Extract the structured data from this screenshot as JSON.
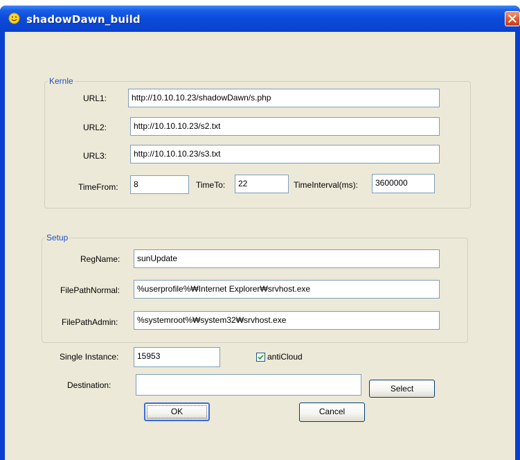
{
  "window": {
    "title": "shadowDawn_build"
  },
  "kernle": {
    "legend": "Kernle",
    "url1_label": "URL1:",
    "url1_value": "http://10.10.10.23/shadowDawn/s.php",
    "url2_label": "URL2:",
    "url2_value": "http://10.10.10.23/s2.txt",
    "url3_label": "URL3:",
    "url3_value": "http://10.10.10.23/s3.txt",
    "timefrom_label": "TimeFrom:",
    "timefrom_value": "8",
    "timeto_label": "TimeTo:",
    "timeto_value": "22",
    "interval_label": "TimeInterval(ms):",
    "interval_value": "3600000"
  },
  "setup": {
    "legend": "Setup",
    "regname_label": "RegName:",
    "regname_value": "sunUpdate",
    "fp_normal_label": "FilePathNormal:",
    "fp_normal_value": "%userprofile%₩Internet Explorer₩srvhost.exe",
    "fp_admin_label": "FilePathAdmin:",
    "fp_admin_value": "%systemroot%₩system32₩srvhost.exe"
  },
  "single_instance": {
    "label": "Single Instance:",
    "value": "15953"
  },
  "anticloud": {
    "label": "antiCloud",
    "checked": true
  },
  "destination": {
    "label": "Destination:",
    "value": ""
  },
  "buttons": {
    "select": "Select",
    "ok": "OK",
    "cancel": "Cancel"
  },
  "icons": {
    "title": "smiley-icon",
    "close": "close-icon",
    "check": "checkmark-icon"
  },
  "colors": {
    "titlebar": "#0a45d0",
    "client": "#ece9d8",
    "legend": "#2050c8",
    "field_border": "#7f9db9",
    "close": "#e05a33"
  }
}
